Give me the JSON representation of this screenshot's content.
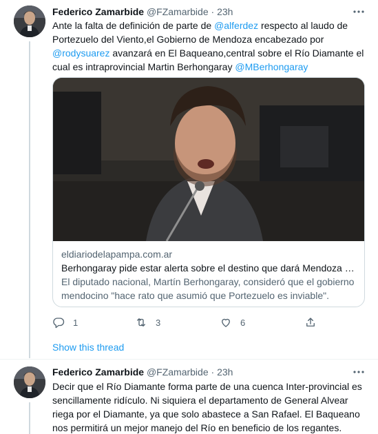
{
  "tweets": [
    {
      "author_name": "Federico Zamarbide",
      "author_handle": "@FZamarbide",
      "separator": "·",
      "time": "23h",
      "body": {
        "t1": "Ante la falta de definición de parte de ",
        "m1": "@alferdez",
        "t2": " respecto al laudo de Portezuelo del Viento,el Gobierno de Mendoza encabezado por ",
        "m2": "@rodysuarez",
        "t3": " avanzará en El Baqueano,central sobre el Río Diamante el cual es intraprovincial Martin Berhongaray ",
        "m3": "@MBerhongaray"
      },
      "card": {
        "domain": "eldiariodelapampa.com.ar",
        "title": "Berhongaray pide estar alerta sobre el destino que dará Mendoza al di...",
        "description": "El diputado nacional, Martín Berhongaray, consideró que el gobierno mendocino \"hace rato que asumió que Portezuelo es inviable\"."
      },
      "actions": {
        "replies": "1",
        "retweets": "3",
        "likes": "6"
      },
      "show_thread": "Show this thread"
    },
    {
      "author_name": "Federico Zamarbide",
      "author_handle": "@FZamarbide",
      "separator": "·",
      "time": "23h",
      "body": "Decir que el Río Diamante forma parte de una cuenca Inter-provincial es sencillamente ridículo. Ni siquiera el departamento de General Alvear riega por el Diamante, ya que solo abastece a San Rafael. El Baqueano nos permitirá un mejor manejo del Río en beneficio de los regantes."
    }
  ],
  "icons": {
    "reply": "reply-icon",
    "retweet": "retweet-icon",
    "like": "heart-icon",
    "share": "share-icon",
    "more": "more-icon"
  },
  "colors": {
    "link": "#1d9bf0",
    "secondary_text": "#536471",
    "primary_text": "#0f1419",
    "border": "#cfd9de"
  }
}
